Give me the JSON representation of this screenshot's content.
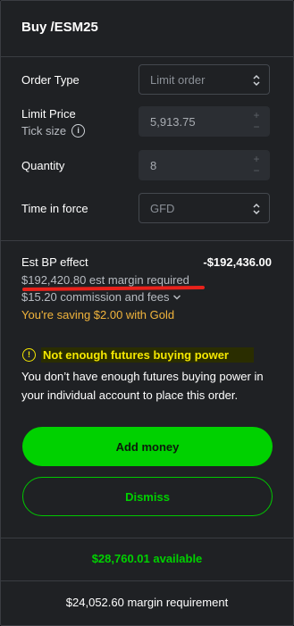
{
  "header": {
    "title": "Buy /ESM25"
  },
  "form": {
    "order_type": {
      "label": "Order Type",
      "value": "Limit order"
    },
    "limit_price": {
      "label": "Limit Price",
      "sub_label": "Tick size",
      "value": "5,913.75"
    },
    "quantity": {
      "label": "Quantity",
      "value": "8"
    },
    "time_in_force": {
      "label": "Time in force",
      "value": "GFD"
    }
  },
  "estimate": {
    "label": "Est BP effect",
    "value": "-$192,436.00",
    "margin_text": "$192,420.80 est margin required",
    "commission_text": "$15.20 commission and fees",
    "gold_text": "You're saving $2.00 with Gold"
  },
  "warning": {
    "title": "Not enough futures buying power",
    "body": "You don’t have enough futures buying power in your individual account to place this order."
  },
  "buttons": {
    "add_money": "Add money",
    "dismiss": "Dismiss"
  },
  "footer": {
    "available": "$28,760.01 available",
    "margin_requirement": "$24,052.60 margin requirement"
  },
  "icons": {
    "info": "info-icon",
    "warning": "warning-icon",
    "chevron": "chevron-down-icon",
    "select_arrows": "up-down-arrows-icon"
  },
  "colors": {
    "accent_green": "#00d100",
    "warning_yellow": "#f5e800",
    "gold": "#f1b43c",
    "annotation_red": "#e8221b"
  }
}
